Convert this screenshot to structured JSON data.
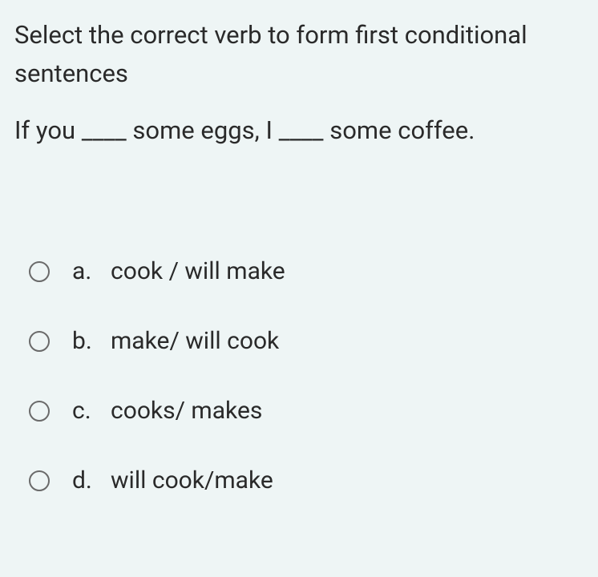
{
  "question": {
    "instruction": "Select the correct verb to form first conditional sentences",
    "sentence": "If you ____ some eggs, I ____ some coffee."
  },
  "options": [
    {
      "letter": "a.",
      "text": "cook / will make"
    },
    {
      "letter": "b.",
      "text": "make/ will cook"
    },
    {
      "letter": "c.",
      "text": "cooks/ makes"
    },
    {
      "letter": "d.",
      "text": "will cook/make"
    }
  ]
}
